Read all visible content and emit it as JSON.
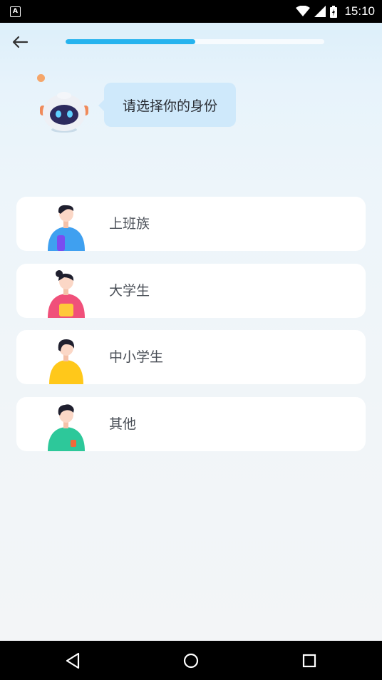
{
  "status_bar": {
    "app_icon_letter": "A",
    "time": "15:10"
  },
  "header": {
    "progress_fraction": 0.5
  },
  "prompt": {
    "text": "请选择你的身份"
  },
  "options": [
    {
      "label": "上班族",
      "shirt_color": "#3fa0f0"
    },
    {
      "label": "大学生",
      "shirt_color": "#f0507a"
    },
    {
      "label": "中小学生",
      "shirt_color": "#ffc81a"
    },
    {
      "label": "其他",
      "shirt_color": "#2dc89a"
    }
  ],
  "icons": {
    "back": "back-arrow-icon",
    "nav_back": "nav-back-icon",
    "nav_home": "nav-home-icon",
    "nav_recents": "nav-recents-icon"
  }
}
